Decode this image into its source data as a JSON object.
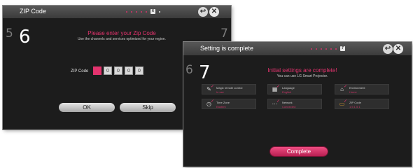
{
  "zip_screen": {
    "title": "ZIP Code",
    "prev_step": "5",
    "step": "6",
    "next_step": "7",
    "progress_current": "6",
    "heading": "Please enter your Zip Code",
    "subtext": "Use the channels and services optimized for your region.",
    "zip_label": "ZIP Code",
    "zip_digits": [
      "0",
      "0",
      "0",
      "0",
      "0"
    ],
    "ok_label": "OK",
    "skip_label": "Skip",
    "icons": {
      "back": "back-arrow-icon",
      "close": "close-icon"
    }
  },
  "complete_screen": {
    "title": "Setting is complete",
    "prev_step": "6",
    "step": "7",
    "progress_current": "7",
    "heading": "Initial settings are complete!",
    "subtext": "You can use LG Smart Projector.",
    "tiles": [
      {
        "name": "Magic remote control",
        "value": "In use",
        "icon": "remote-icon"
      },
      {
        "name": "Language",
        "value": "English",
        "icon": "language-icon"
      },
      {
        "name": "Environment",
        "value": "Home",
        "icon": "home-icon"
      },
      {
        "name": "Time Zone",
        "value": "Eastern",
        "icon": "clock-icon"
      },
      {
        "name": "Network",
        "value": "Connected",
        "icon": "network-icon"
      },
      {
        "name": "ZIP Code",
        "value": "1 5 1 5 1",
        "icon": "zip-icon"
      }
    ],
    "complete_label": "Complete",
    "icons": {
      "back": "back-arrow-icon",
      "close": "close-icon"
    }
  },
  "colors": {
    "accent": "#e4336e",
    "screen_bg": "#1c1c1c",
    "titlebar": "#4a4a4a",
    "page_bg": "#ffffff"
  }
}
